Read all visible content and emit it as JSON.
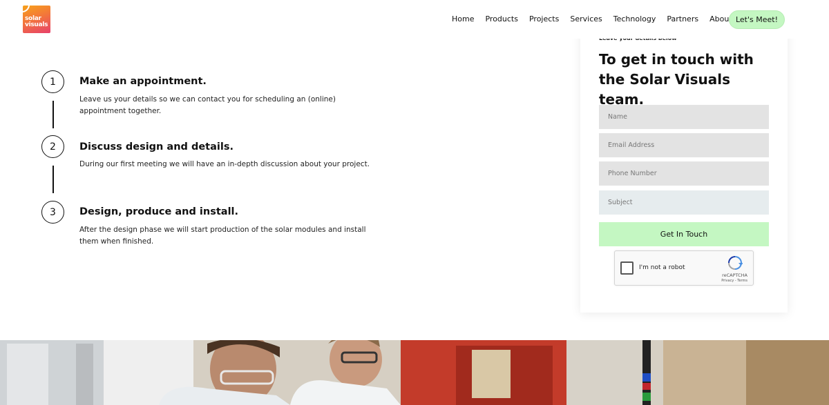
{
  "logo": {
    "line1": "solar",
    "line2": "visuals"
  },
  "nav": {
    "items": [
      "Home",
      "Products",
      "Projects",
      "Services",
      "Technology",
      "Partners"
    ],
    "about_label": "About",
    "cta_label": "Let's Meet!"
  },
  "steps": [
    {
      "number": "1",
      "title": "Make an appointment.",
      "description": "Leave us your details so we can contact you for scheduling an (online) appointment together."
    },
    {
      "number": "2",
      "title": "Discuss design and details.",
      "description": "During our first meeting we will have an in-depth discussion about your project."
    },
    {
      "number": "3",
      "title": "Design, produce and install.",
      "description": "After the design phase we will start production of the solar modules and install them when finished."
    }
  ],
  "form": {
    "eyebrow": "Leave your details below",
    "title": "To get in touch with the Solar Visuals team.",
    "fields": [
      {
        "placeholder": "Name"
      },
      {
        "placeholder": "Email Address"
      },
      {
        "placeholder": "Phone Number"
      },
      {
        "placeholder": "Subject"
      }
    ],
    "submit_label": "Get In Touch",
    "captcha": {
      "label": "I'm not a robot",
      "brand": "reCAPTCHA",
      "links": "Privacy - Terms"
    }
  },
  "colors": {
    "accent_green": "#c4f7c2",
    "field_gray": "#e3e3e3",
    "logo_orange": "#f3773a",
    "logo_pink": "#e7406b"
  },
  "icons": [
    "caret-down-icon",
    "recaptcha-icon",
    "logo-sun-icon"
  ]
}
